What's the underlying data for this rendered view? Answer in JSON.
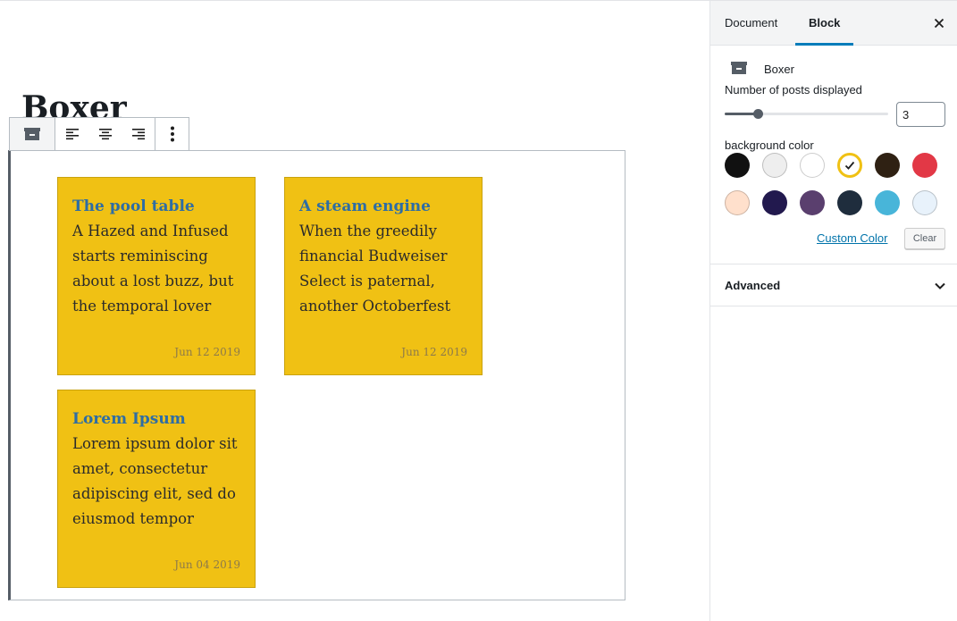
{
  "post": {
    "title": "Boxer"
  },
  "cards": [
    {
      "title": "The pool table",
      "excerpt": "A Hazed and Infused starts reminiscing about a lost buzz, but the temporal lover",
      "date": "Jun 12 2019"
    },
    {
      "title": "A steam engine",
      "excerpt": "When the greedily financial Budweiser Select is paternal, another Octoberfest",
      "date": "Jun 12 2019"
    },
    {
      "title": "Lorem Ipsum",
      "excerpt": "Lorem ipsum dolor sit amet, consectetur adipiscing elit, sed do eiusmod tempor",
      "date": "Jun 04 2019"
    }
  ],
  "toolbar": {
    "icons": [
      "block-type-icon",
      "align-left-icon",
      "align-center-icon",
      "align-right-icon",
      "more-options-icon"
    ]
  },
  "sidebar": {
    "tabs": [
      {
        "label": "Document",
        "active": false
      },
      {
        "label": "Block",
        "active": true
      }
    ],
    "block_name": "Boxer",
    "posts_label": "Number of posts displayed",
    "posts_value": "3",
    "posts_slider_fraction": 0.2,
    "bg_label": "background color",
    "palette": [
      "#111111",
      "#eeeeee",
      "#ffffff",
      "#f0c114",
      "#2f2113",
      "#e23846",
      "#ffe0cc",
      "#22194e",
      "#5a3f6e",
      "#1f2d3d",
      "#48b5d9",
      "#e8f2fb"
    ],
    "selected_color": "#f0c114",
    "custom_color_label": "Custom Color",
    "clear_label": "Clear",
    "advanced_label": "Advanced"
  },
  "colors": {
    "card_bg": "#f0c114",
    "card_title": "#2e6da4",
    "accent": "#007cba"
  }
}
